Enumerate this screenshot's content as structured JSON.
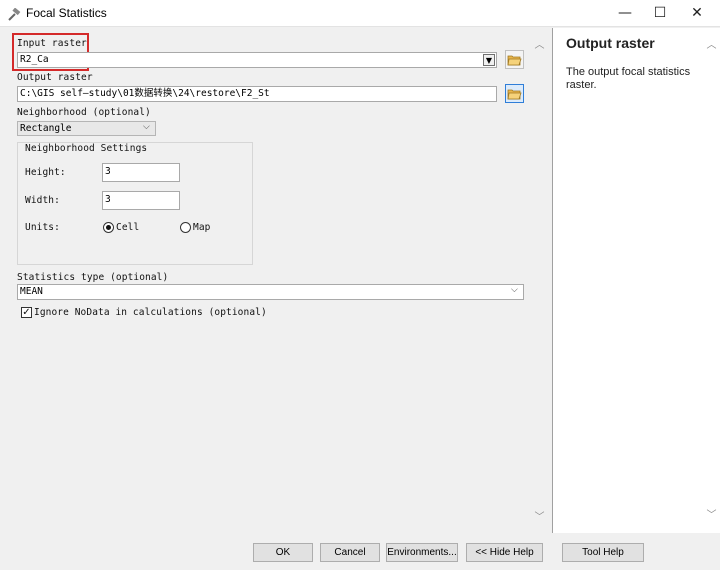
{
  "window": {
    "title": "Focal Statistics"
  },
  "form": {
    "input_raster": {
      "label": "Input raster",
      "value": "R2_Ca"
    },
    "output_raster": {
      "label": "Output raster",
      "value": "C:\\GIS  self—study\\01数据转换\\24\\restore\\F2_St"
    },
    "neighborhood": {
      "label": "Neighborhood (optional)",
      "value": "Rectangle"
    },
    "settings": {
      "title": "Neighborhood Settings",
      "height_label": "Height:",
      "height_value": "3",
      "width_label": "Width:",
      "width_value": "3",
      "units_label": "Units:",
      "cell_label": "Cell",
      "map_label": "Map"
    },
    "statistics_type": {
      "label": "Statistics type (optional)",
      "value": "MEAN"
    },
    "ignore_nodata": {
      "label": "Ignore NoData in calculations (optional)",
      "checked": true
    }
  },
  "buttons": {
    "ok": "OK",
    "cancel": "Cancel",
    "environments": "Environments...",
    "hide_help": "<< Hide Help",
    "tool_help": "Tool Help"
  },
  "help": {
    "title": "Output raster",
    "text": "The output focal statistics raster."
  },
  "colors": {
    "highlight": "#d42a2a",
    "accent": "#2f7ed8"
  }
}
